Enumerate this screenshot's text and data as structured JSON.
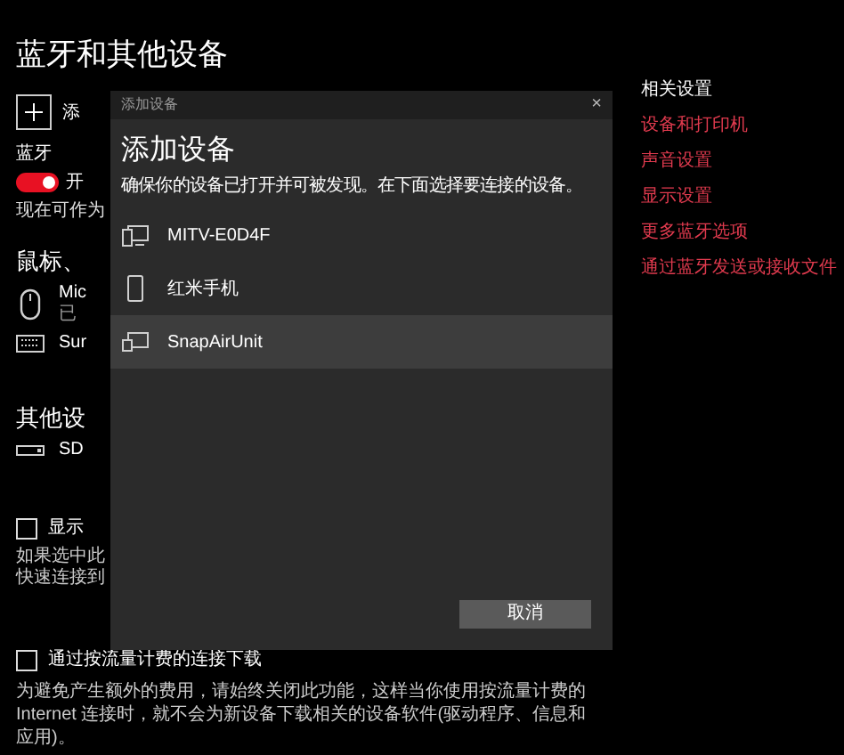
{
  "page": {
    "title": "蓝牙和其他设备",
    "add_device_label": "添",
    "bluetooth": {
      "label": "蓝牙",
      "on": true,
      "state_label": "开"
    },
    "discoverable_text": "现在可作为",
    "mouse_section": {
      "heading": "鼠标、",
      "devices": [
        {
          "kind": "mouse",
          "name": "Mic",
          "status": "已"
        },
        {
          "kind": "keyboard",
          "name": "Sur"
        }
      ]
    },
    "other_section": {
      "heading": "其他设",
      "devices": [
        {
          "kind": "dongle",
          "name": "SD"
        }
      ]
    },
    "swift_pair": {
      "label": "显示",
      "checked": false,
      "description_lines": [
        "如果选中此",
        "快速连接到"
      ]
    },
    "metered": {
      "label": "通过按流量计费的连接下载",
      "checked": false,
      "description": "为避免产生额外的费用，请始终关闭此功能，这样当你使用按流量计费的 Internet 连接时，就不会为新设备下载相关的设备软件(驱动程序、信息和应用)。"
    }
  },
  "related_settings": {
    "title": "相关设置",
    "links": [
      "设备和打印机",
      "声音设置",
      "显示设置",
      "更多蓝牙选项",
      "通过蓝牙发送或接收文件"
    ]
  },
  "dialog": {
    "window_title": "添加设备",
    "close": "×",
    "heading": "添加设备",
    "description": "确保你的设备已打开并可被发现。在下面选择要连接的设备。",
    "devices": [
      {
        "kind": "tv",
        "name": "MITV-E0D4F",
        "selected": false
      },
      {
        "kind": "phone",
        "name": "红米手机",
        "selected": false
      },
      {
        "kind": "display",
        "name": "SnapAirUnit",
        "selected": true
      }
    ],
    "cancel_button": "取消"
  }
}
